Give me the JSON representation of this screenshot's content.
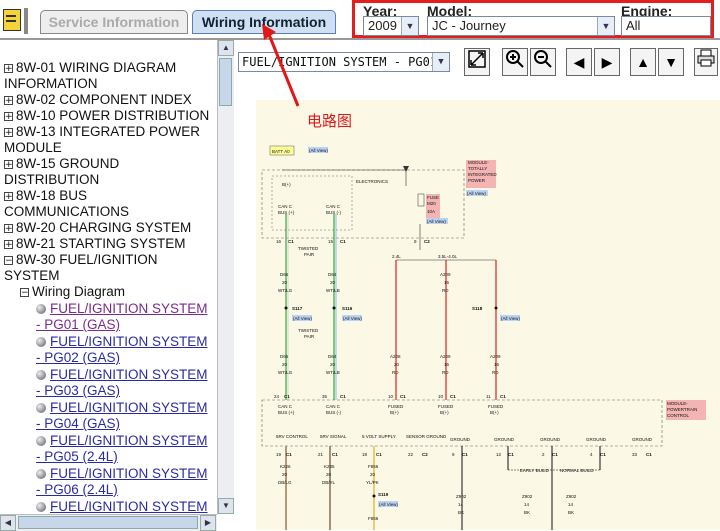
{
  "tabs": [
    {
      "label": "Service Information"
    },
    {
      "label": "Wiring Information"
    }
  ],
  "selectors": {
    "year": {
      "label": "Year:",
      "value": "2009"
    },
    "model": {
      "label": "Model:",
      "value": "JC - Journey"
    },
    "engine": {
      "label": "Engine:",
      "value": "All"
    }
  },
  "tree": {
    "items": [
      "8W-01 WIRING DIAGRAM",
      "INFORMATION",
      "8W-02 COMPONENT INDEX",
      "8W-10 POWER DISTRIBUTION",
      "8W-13 INTEGRATED POWER",
      "MODULE",
      "8W-15 GROUND",
      "DISTRIBUTION",
      "8W-18 BUS",
      "COMMUNICATIONS",
      "8W-20 CHARGING SYSTEM",
      "8W-21 STARTING SYSTEM",
      "8W-30 FUEL/IGNITION",
      "SYSTEM"
    ],
    "sub": "Wiring Diagram",
    "links": [
      {
        "t": "FUEL/IGNITION SYSTEM",
        "p": "- PG01 (GAS)"
      },
      {
        "t": "FUEL/IGNITION SYSTEM",
        "p": "- PG02 (GAS)"
      },
      {
        "t": "FUEL/IGNITION SYSTEM",
        "p": "- PG03 (GAS)"
      },
      {
        "t": "FUEL/IGNITION SYSTEM",
        "p": "- PG04 (GAS)"
      },
      {
        "t": "FUEL/IGNITION SYSTEM",
        "p": "- PG05 (2.4L)"
      },
      {
        "t": "FUEL/IGNITION SYSTEM",
        "p": "- PG06 (2.4L)"
      },
      {
        "t": "FUEL/IGNITION SYSTEM",
        "p": ""
      }
    ]
  },
  "viewer": {
    "page": "FUEL/IGNITION SYSTEM - PG01",
    "callout": "电路图"
  },
  "diagram": {
    "batt": "BATT A0",
    "allview": "(All View)",
    "module1": [
      "MODULE-",
      "TOTALLY",
      "INTEGRATED",
      "POWER"
    ],
    "electronics": "ELECTRONICS",
    "bplus": "B(+)",
    "canc": "CAN C",
    "busp": "BUS (+)",
    "busm": "BUS (-)",
    "fuse": "FUSE",
    "m20": "M20",
    "a10": "10A",
    "c1": "C1",
    "c2": "C2",
    "n16": "16",
    "n15": "15",
    "n9": "9",
    "n20": "20",
    "n24": "24",
    "n21": "21",
    "n35": "35",
    "n10": "10",
    "n11": "11",
    "n18": "18",
    "n22": "22",
    "n12": "12",
    "n2": "2",
    "n4": "4",
    "n33": "33",
    "n19": "19",
    "n14": "14",
    "twisted": "TWISTED",
    "pair": "PAIR",
    "d65": "D65",
    "d64": "D64",
    "wtlg": "WT/LG",
    "wtlb": "WT/LB",
    "s117": "S117",
    "s116": "S116",
    "s118": "S118",
    "tlr": "2.4L",
    "tlr2": "3.5L-4.0L",
    "a209": "A209",
    "a208": "A208",
    "rd": "RD",
    "module2": [
      "MODULE-",
      "POWERTRAIN",
      "CONTROL"
    ],
    "fused": "FUSED",
    "bottom": [
      "5RV CONTROL",
      "5RV SIGNAL",
      "5 VOLT SUPPLY",
      "SENSOR GROUND",
      "GROUND",
      "GROUND",
      "GROUND",
      "GROUND",
      "GROUND"
    ],
    "k226": "K226",
    "k235": "K235",
    "f856": "F856",
    "dbl": "DB/LG",
    "dbl2": "DB/YL",
    "ylpk": "YL/PK",
    "z902": "Z902",
    "bk": "BK",
    "early": "EARLY BUILD",
    "normal": "NORMAL BUILD",
    "s119": "S119"
  }
}
